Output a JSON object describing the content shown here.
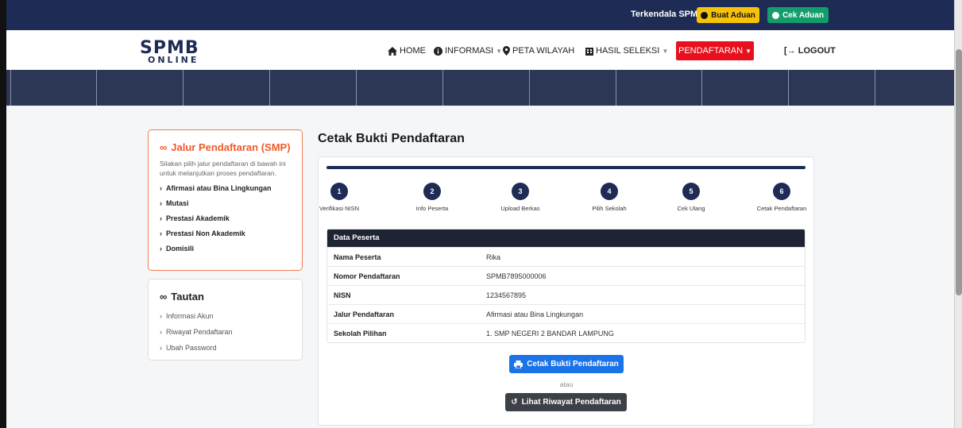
{
  "topbar": {
    "trouble_text": "Terkendala SPMB ?",
    "buat_aduan": "Buat Aduan",
    "cek_aduan": "Cek Aduan",
    "colors": {
      "bar": "#1e2c55",
      "aduan": "#f7c30a",
      "cek": "#139d6b"
    }
  },
  "logo": {
    "line1": "SPMB",
    "line2": "ONLINE"
  },
  "nav": {
    "home": "HOME",
    "informasi": "INFORMASI",
    "peta": "PETA WILAYAH",
    "hasil": "HASIL SELEKSI",
    "pendaftaran": "PENDAFTARAN",
    "logout": "LOGOUT",
    "icons": [
      "home-icon",
      "info-icon",
      "map-pin-icon",
      "building-icon",
      "logout-icon"
    ]
  },
  "jalur": {
    "title": "Jalur Pendaftaran (SMP)",
    "desc": "Silakan pilih jalur pendaftaran di bawah ini untuk melanjutkan proses pendaftaran.",
    "items": [
      "Afirmasi atau Bina Lingkungan",
      "Mutasi",
      "Prestasi Akademik",
      "Prestasi Non Akademik",
      "Domisili"
    ],
    "accent": "#f05a28"
  },
  "tautan": {
    "title": "Tautan",
    "items": [
      "Informasi Akun",
      "Riwayat Pendaftaran",
      "Ubah Password"
    ]
  },
  "page": {
    "title": "Cetak Bukti Pendaftaran"
  },
  "steps": [
    {
      "num": "1",
      "label": "Verifikasi NISN"
    },
    {
      "num": "2",
      "label": "Info Peserta"
    },
    {
      "num": "3",
      "label": "Upload Berkas"
    },
    {
      "num": "4",
      "label": "Pilih Sekolah"
    },
    {
      "num": "5",
      "label": "Cek Ulang"
    },
    {
      "num": "6",
      "label": "Cetak Pendaftaran"
    }
  ],
  "peserta": {
    "heading": "Data Peserta",
    "rows": [
      {
        "key": "Nama Peserta",
        "value": "Rika"
      },
      {
        "key": "Nomor Pendaftaran",
        "value": "SPMB7895000006"
      },
      {
        "key": "NISN",
        "value": "1234567895"
      },
      {
        "key": "Jalur Pendaftaran",
        "value": "Afirmasi atau Bina Lingkungan"
      },
      {
        "key": "Sekolah Pilihan",
        "value": "1. SMP NEGERI 2 BANDAR LAMPUNG"
      }
    ]
  },
  "actions": {
    "cetak": "Cetak Bukti Pendaftaran",
    "atau": "atau",
    "riwayat": "Lihat Riwayat Pendaftaran"
  }
}
